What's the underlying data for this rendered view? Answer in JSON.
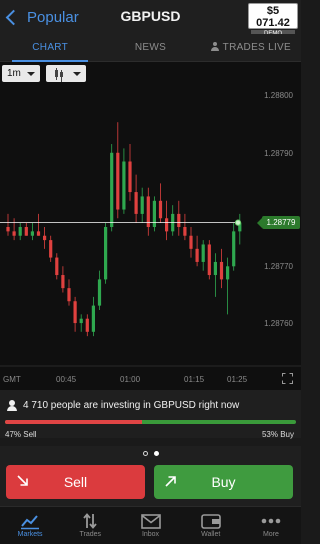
{
  "header": {
    "back_label": "Popular",
    "title": "GBPUSD",
    "balance_amount": "$5 071.42",
    "balance_label": "DEMO ACCOUNT"
  },
  "tabs": [
    {
      "label": "CHART",
      "active": true
    },
    {
      "label": "NEWS",
      "active": false
    },
    {
      "label": "TRADES LIVE",
      "active": false
    }
  ],
  "chart_controls": {
    "interval": "1m",
    "chart_type_icon": "candlestick-icon"
  },
  "chart_data": {
    "type": "candlestick",
    "symbol": "GBPUSD",
    "y_ticks": [
      "1.28800",
      "1.28790",
      "1.28770",
      "1.28760"
    ],
    "ylim": [
      1.28748,
      1.28808
    ],
    "current_price": "1.28779",
    "current_price_value": 1.28779,
    "x_ticks": [
      "GMT",
      "00:45",
      "01:00",
      "01:15",
      "01:25"
    ],
    "x_tick_minutes": [
      -60,
      45,
      60,
      75,
      85
    ],
    "start_minute": 34,
    "colors": {
      "up": "#2fa84f",
      "down": "#e0413f",
      "price_line": "#ffffff"
    },
    "candles": [
      {
        "o": 1.28778,
        "h": 1.28781,
        "l": 1.28776,
        "c": 1.28777
      },
      {
        "o": 1.28777,
        "h": 1.2878,
        "l": 1.28775,
        "c": 1.28776
      },
      {
        "o": 1.28776,
        "h": 1.28779,
        "l": 1.28775,
        "c": 1.28778
      },
      {
        "o": 1.28778,
        "h": 1.28779,
        "l": 1.28776,
        "c": 1.28776
      },
      {
        "o": 1.28776,
        "h": 1.28779,
        "l": 1.28775,
        "c": 1.28777
      },
      {
        "o": 1.28777,
        "h": 1.28781,
        "l": 1.28776,
        "c": 1.28776
      },
      {
        "o": 1.28776,
        "h": 1.28778,
        "l": 1.28773,
        "c": 1.28775
      },
      {
        "o": 1.28775,
        "h": 1.28776,
        "l": 1.2877,
        "c": 1.28771
      },
      {
        "o": 1.28771,
        "h": 1.28772,
        "l": 1.28766,
        "c": 1.28767
      },
      {
        "o": 1.28767,
        "h": 1.28769,
        "l": 1.28763,
        "c": 1.28764
      },
      {
        "o": 1.28764,
        "h": 1.28766,
        "l": 1.2876,
        "c": 1.28761
      },
      {
        "o": 1.28761,
        "h": 1.28762,
        "l": 1.28754,
        "c": 1.28756
      },
      {
        "o": 1.28756,
        "h": 1.28758,
        "l": 1.28754,
        "c": 1.28757
      },
      {
        "o": 1.28757,
        "h": 1.28758,
        "l": 1.28753,
        "c": 1.28754
      },
      {
        "o": 1.28754,
        "h": 1.28762,
        "l": 1.28753,
        "c": 1.2876
      },
      {
        "o": 1.2876,
        "h": 1.28768,
        "l": 1.28759,
        "c": 1.28766
      },
      {
        "o": 1.28766,
        "h": 1.28779,
        "l": 1.28765,
        "c": 1.28778
      },
      {
        "o": 1.28778,
        "h": 1.28797,
        "l": 1.28777,
        "c": 1.28795
      },
      {
        "o": 1.28795,
        "h": 1.28802,
        "l": 1.2878,
        "c": 1.28782
      },
      {
        "o": 1.28782,
        "h": 1.28796,
        "l": 1.28781,
        "c": 1.28793
      },
      {
        "o": 1.28793,
        "h": 1.28797,
        "l": 1.28784,
        "c": 1.28786
      },
      {
        "o": 1.28786,
        "h": 1.2879,
        "l": 1.28779,
        "c": 1.28781
      },
      {
        "o": 1.28781,
        "h": 1.28787,
        "l": 1.28779,
        "c": 1.28785
      },
      {
        "o": 1.28785,
        "h": 1.28787,
        "l": 1.28776,
        "c": 1.28778
      },
      {
        "o": 1.28778,
        "h": 1.28785,
        "l": 1.28777,
        "c": 1.28784
      },
      {
        "o": 1.28784,
        "h": 1.28788,
        "l": 1.28779,
        "c": 1.2878
      },
      {
        "o": 1.2878,
        "h": 1.28784,
        "l": 1.28775,
        "c": 1.28777
      },
      {
        "o": 1.28777,
        "h": 1.28783,
        "l": 1.28776,
        "c": 1.28781
      },
      {
        "o": 1.28781,
        "h": 1.28784,
        "l": 1.28776,
        "c": 1.28778
      },
      {
        "o": 1.28778,
        "h": 1.28781,
        "l": 1.28775,
        "c": 1.28776
      },
      {
        "o": 1.28776,
        "h": 1.28778,
        "l": 1.28771,
        "c": 1.28773
      },
      {
        "o": 1.28773,
        "h": 1.28776,
        "l": 1.28769,
        "c": 1.2877
      },
      {
        "o": 1.2877,
        "h": 1.28775,
        "l": 1.28768,
        "c": 1.28774
      },
      {
        "o": 1.28774,
        "h": 1.28775,
        "l": 1.28766,
        "c": 1.28767
      },
      {
        "o": 1.28767,
        "h": 1.28772,
        "l": 1.28762,
        "c": 1.2877
      },
      {
        "o": 1.2877,
        "h": 1.28773,
        "l": 1.28764,
        "c": 1.28766
      },
      {
        "o": 1.28766,
        "h": 1.28771,
        "l": 1.28758,
        "c": 1.28769
      },
      {
        "o": 1.28769,
        "h": 1.28779,
        "l": 1.28768,
        "c": 1.28777
      },
      {
        "o": 1.28777,
        "h": 1.28781,
        "l": 1.28774,
        "c": 1.28779
      }
    ]
  },
  "investing": {
    "text": "4 710 people are investing in GBPUSD right now",
    "sell_fraction": 0.47,
    "sell_label": "47% Sell",
    "buy_label": "53% Buy"
  },
  "pager": {
    "active_index": 1,
    "count": 2
  },
  "actions": {
    "sell_label": "Sell",
    "buy_label": "Buy"
  },
  "nav": [
    {
      "label": "Markets",
      "icon": "markets-chart-icon",
      "active": true
    },
    {
      "label": "Trades",
      "icon": "trades-arrows-icon",
      "active": false
    },
    {
      "label": "Inbox",
      "icon": "envelope-icon",
      "active": false
    },
    {
      "label": "Wallet",
      "icon": "wallet-icon",
      "active": false
    },
    {
      "label": "More",
      "icon": "more-dots-icon",
      "active": false
    }
  ]
}
